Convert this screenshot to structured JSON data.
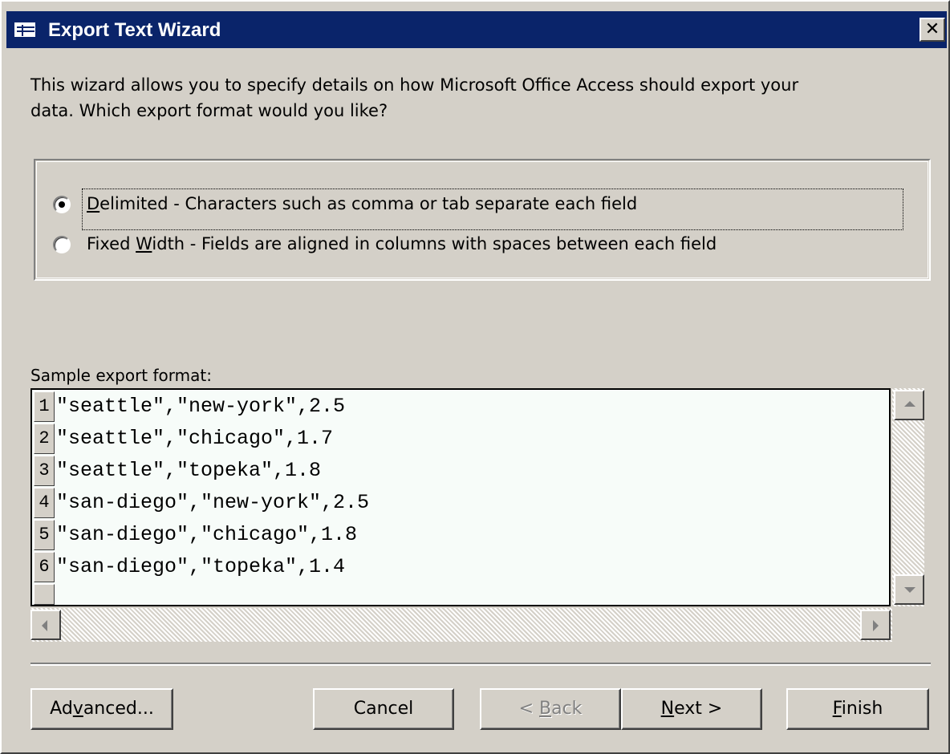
{
  "window": {
    "title": "Export Text Wizard",
    "close_label": "✕"
  },
  "intro": {
    "line1": "This wizard allows you to specify details on how Microsoft Office Access should export your",
    "line2": "data. Which export format would you like?"
  },
  "format_options": {
    "delimited": {
      "mnemonic": "D",
      "label_rest": "elimited - Characters such as comma or tab separate each field",
      "selected": true
    },
    "fixed_width": {
      "label_pre": "Fixed ",
      "mnemonic": "W",
      "label_rest": "idth - Fields are aligned in columns with spaces between each field",
      "selected": false
    }
  },
  "sample": {
    "label": "Sample export format:",
    "rows": [
      {
        "num": "1",
        "text": "\"seattle\",\"new-york\",2.5"
      },
      {
        "num": "2",
        "text": "\"seattle\",\"chicago\",1.7"
      },
      {
        "num": "3",
        "text": "\"seattle\",\"topeka\",1.8"
      },
      {
        "num": "4",
        "text": "\"san-diego\",\"new-york\",2.5"
      },
      {
        "num": "5",
        "text": "\"san-diego\",\"chicago\",1.8"
      },
      {
        "num": "6",
        "text": "\"san-diego\",\"topeka\",1.4"
      }
    ]
  },
  "buttons": {
    "advanced": {
      "pre": "Ad",
      "mnemonic": "v",
      "post": "anced..."
    },
    "cancel": {
      "label": "Cancel"
    },
    "back": {
      "pre": "< ",
      "mnemonic": "B",
      "post": "ack",
      "disabled": true
    },
    "next": {
      "mnemonic": "N",
      "post": "ext >"
    },
    "finish": {
      "mnemonic": "F",
      "post": "inish"
    }
  },
  "colors": {
    "titlebar": "#0a246a",
    "face": "#d4d0c8",
    "listbox_bg": "#f7fcf9"
  }
}
